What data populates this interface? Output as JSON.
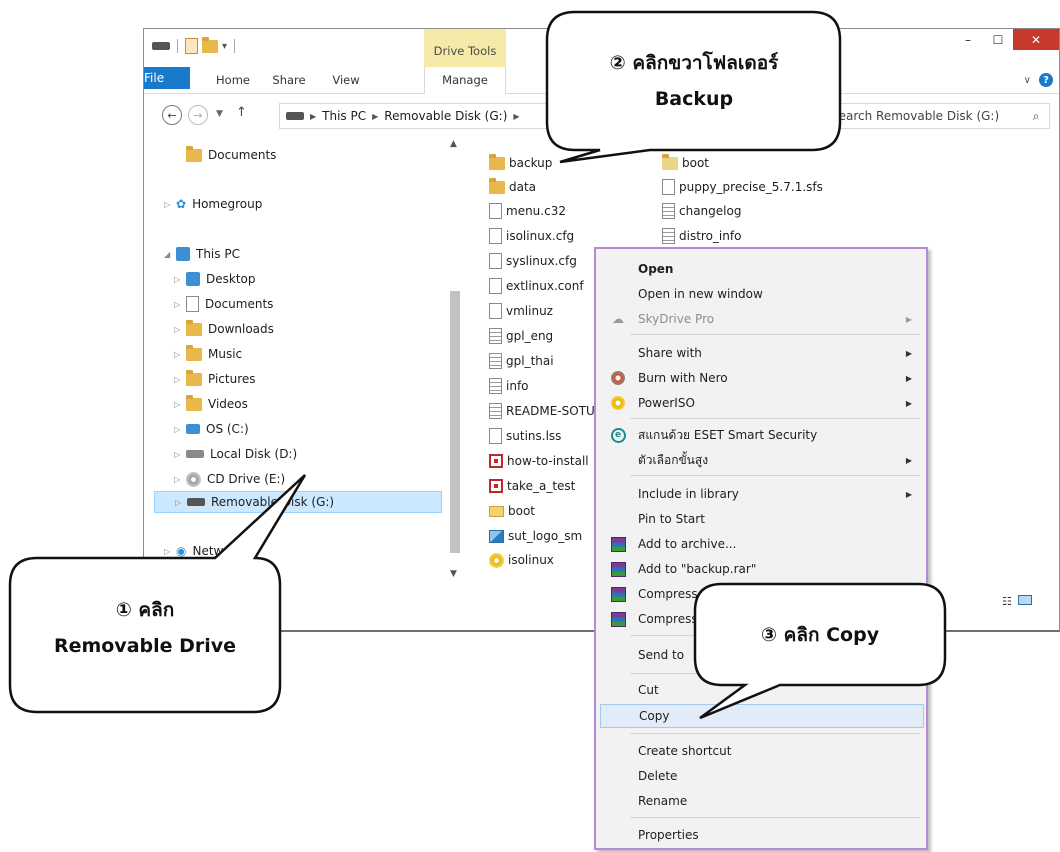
{
  "window": {
    "drive_tools": "Drive Tools",
    "tabs": [
      "File",
      "Home",
      "Share",
      "View",
      "Manage"
    ],
    "address": {
      "crumbs": [
        "This PC",
        "Removable Disk (G:)"
      ]
    },
    "search_placeholder": "Search Removable Disk (G:)"
  },
  "nav": {
    "items": [
      {
        "label": "Documents",
        "icon": "folder-icon"
      },
      {
        "label": "Homegroup",
        "icon": "homegroup-icon"
      },
      {
        "label": "This PC",
        "icon": "computer-icon"
      },
      {
        "label": "Desktop",
        "icon": "desktop-icon"
      },
      {
        "label": "Documents",
        "icon": "documents-icon"
      },
      {
        "label": "Downloads",
        "icon": "downloads-icon"
      },
      {
        "label": "Music",
        "icon": "music-icon"
      },
      {
        "label": "Pictures",
        "icon": "pictures-icon"
      },
      {
        "label": "Videos",
        "icon": "videos-icon"
      },
      {
        "label": "OS (C:)",
        "icon": "os-drive-icon"
      },
      {
        "label": "Local Disk (D:)",
        "icon": "disk-icon"
      },
      {
        "label": "CD Drive (E:)",
        "icon": "cd-drive-icon"
      },
      {
        "label": "Removable Disk (G:)",
        "icon": "removable-drive-icon"
      },
      {
        "label": "Network",
        "icon": "network-icon"
      }
    ]
  },
  "files": {
    "col1": [
      {
        "name": "backup",
        "icon": "folder-icon"
      },
      {
        "name": "data",
        "icon": "folder-icon"
      },
      {
        "name": "menu.c32",
        "icon": "file-icon"
      },
      {
        "name": "isolinux.cfg",
        "icon": "file-icon"
      },
      {
        "name": "syslinux.cfg",
        "icon": "file-icon"
      },
      {
        "name": "extlinux.conf",
        "icon": "file-icon"
      },
      {
        "name": "vmlinuz",
        "icon": "file-icon"
      },
      {
        "name": "gpl_eng",
        "icon": "text-file-icon"
      },
      {
        "name": "gpl_thai",
        "icon": "text-file-icon"
      },
      {
        "name": "info",
        "icon": "text-file-icon"
      },
      {
        "name": "README-SOTUS",
        "icon": "text-file-icon"
      },
      {
        "name": "sutins.lss",
        "icon": "file-icon"
      },
      {
        "name": "how-to-install",
        "icon": "presentation-icon"
      },
      {
        "name": "take_a_test",
        "icon": "presentation-icon"
      },
      {
        "name": "boot",
        "icon": "mail-icon"
      },
      {
        "name": "sut_logo_sm",
        "icon": "image-icon"
      },
      {
        "name": "isolinux",
        "icon": "disc-image-icon"
      }
    ],
    "col2": [
      {
        "name": "boot",
        "icon": "boot-file-icon"
      },
      {
        "name": "puppy_precise_5.7.1.sfs",
        "icon": "file-icon"
      },
      {
        "name": "changelog",
        "icon": "text-file-icon"
      },
      {
        "name": "distro_info",
        "icon": "text-file-icon"
      }
    ]
  },
  "context_menu": {
    "items": [
      {
        "label": "Open",
        "bold": true
      },
      {
        "label": "Open in new window"
      },
      {
        "label": "SkyDrive Pro",
        "disabled": true,
        "submenu": true,
        "icon": "skydrive-icon"
      },
      {
        "label": "Share with",
        "submenu": true
      },
      {
        "label": "Burn with Nero",
        "submenu": true,
        "icon": "nero-icon"
      },
      {
        "label": "PowerISO",
        "submenu": true,
        "icon": "poweriso-icon"
      },
      {
        "label": "สแกนด้วย ESET Smart Security",
        "icon": "eset-icon"
      },
      {
        "label": "ตัวเลือกขั้นสูง",
        "submenu": true
      },
      {
        "label": "Include in library",
        "submenu": true
      },
      {
        "label": "Pin to Start"
      },
      {
        "label": "Add to archive...",
        "icon": "winrar-icon"
      },
      {
        "label": "Add to \"backup.rar\"",
        "icon": "winrar-icon"
      },
      {
        "label": "Compress and email...",
        "icon": "winrar-icon"
      },
      {
        "label": "Compress to \"backup.rar\" and email",
        "icon": "winrar-icon"
      },
      {
        "label": "Send to",
        "submenu": true
      },
      {
        "label": "Cut"
      },
      {
        "label": "Copy",
        "highlight": true
      },
      {
        "label": "Create shortcut"
      },
      {
        "label": "Delete"
      },
      {
        "label": "Rename"
      },
      {
        "label": "Properties"
      }
    ]
  },
  "callouts": {
    "one": {
      "line1": "① คลิก",
      "line2": "Removable Drive"
    },
    "two": {
      "line1": "② คลิกขวาโฟลเดอร์",
      "line2": "Backup"
    },
    "three": {
      "line1": "③ คลิก Copy"
    }
  },
  "colors": {
    "file_tab": "#1979ca",
    "drive_tools": "#f5eaa8",
    "selection": "#cce8ff",
    "menu_border": "#b48ad6",
    "close_button": "#c7392d"
  }
}
